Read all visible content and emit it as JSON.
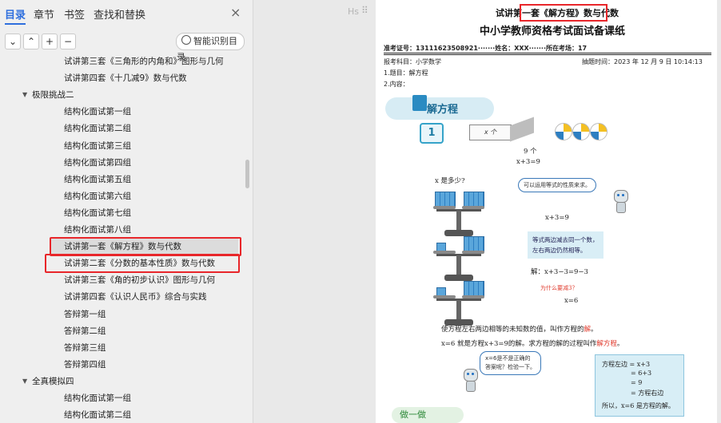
{
  "left_panel": {
    "tabs": [
      {
        "label": "目录",
        "active": true
      },
      {
        "label": "章节",
        "active": false
      },
      {
        "label": "书签",
        "active": false
      },
      {
        "label": "查找和替换",
        "active": false
      }
    ],
    "close_symbol": "×",
    "toolbar": {
      "collapse_symbol": "⌄",
      "expand_symbol": "⌃",
      "add_symbol": "+",
      "remove_symbol": "−",
      "smart_button_label": "智能识别目录"
    },
    "outline": [
      {
        "text": "试讲第三套《三角形的内角和》图形与几何",
        "level": 2
      },
      {
        "text": "试讲第四套《十几减9》数与代数",
        "level": 2
      },
      {
        "text": "极限挑战二",
        "level": 1
      },
      {
        "text": "结构化面试第一组",
        "level": 2
      },
      {
        "text": "结构化面试第二组",
        "level": 2
      },
      {
        "text": "结构化面试第三组",
        "level": 2
      },
      {
        "text": "结构化面试第四组",
        "level": 2
      },
      {
        "text": "结构化面试第五组",
        "level": 2
      },
      {
        "text": "结构化面试第六组",
        "level": 2
      },
      {
        "text": "结构化面试第七组",
        "level": 2
      },
      {
        "text": "结构化面试第八组",
        "level": 2
      },
      {
        "text": "试讲第一套《解方程》数与代数",
        "level": 2,
        "selected": true
      },
      {
        "text": "试讲第二套《分数的基本性质》数与代数",
        "level": 2
      },
      {
        "text": "试讲第三套《角的初步认识》图形与几何",
        "level": 2
      },
      {
        "text": "试讲第四套《认识人民币》综合与实践",
        "level": 2
      },
      {
        "text": "答辩第一组",
        "level": 2
      },
      {
        "text": "答辩第二组",
        "level": 2
      },
      {
        "text": "答辩第三组",
        "level": 2
      },
      {
        "text": "答辩第四组",
        "level": 2
      },
      {
        "text": "全真模拟四",
        "level": 1
      },
      {
        "text": "结构化面试第一组",
        "level": 2
      },
      {
        "text": "结构化面试第二组",
        "level": 2
      }
    ]
  },
  "doc": {
    "hs_label": "Hs",
    "drag_handle": "⠿",
    "heading": "试讲第一套《解方程》数与代数",
    "subtitle": "中小学教师资格考试面试备课纸",
    "info_line": "准考证号：13111623508921·······姓名：XXX·······所在考场：17",
    "subject_left": "报考科目：小学数学",
    "subject_right": "抽题时间：2023 年 12 月 9 日 10:14:13",
    "item1": "1.题目：解方程",
    "item2": "2.内容：",
    "para_mark": "↵",
    "banner_title": "解方程",
    "section_number": "1",
    "block_label": "x 个",
    "count_label": "9 个",
    "equation_top": "x+3=9",
    "question": "x 是多少?",
    "bubble1": "可以运用等式的性质来求。",
    "equation_mid": "x+3=9",
    "tip": [
      "等式两边减去同一个数，",
      "左右两边仍然相等。"
    ],
    "solution": "解：x+3−3=9−3",
    "why": "为什么要减3？",
    "result": "x=6",
    "definition_pre": "使方程左右两边相等的未知数的值，叫作方程的",
    "definition_key": "解",
    "definition_post": "。",
    "statement_pre": "x=6 就是方程x+3=9的解。求方程的解的过程叫作",
    "statement_key": "解方程",
    "statement_post": "。",
    "bubble2": [
      "x=6是不是正确的",
      "答案呢？检验一下。"
    ],
    "check_lines": [
      "方程左边 = x+3",
      "= 6+3",
      "= 9",
      "= 方程右边",
      "所以，x=6 是方程的解。"
    ],
    "practice_label": "做一做"
  },
  "colors": {
    "accent": "#2f6fde",
    "highlight_red": "#e8262a",
    "banner": "#d7ecf4",
    "tip_bg": "#d9eef6"
  }
}
